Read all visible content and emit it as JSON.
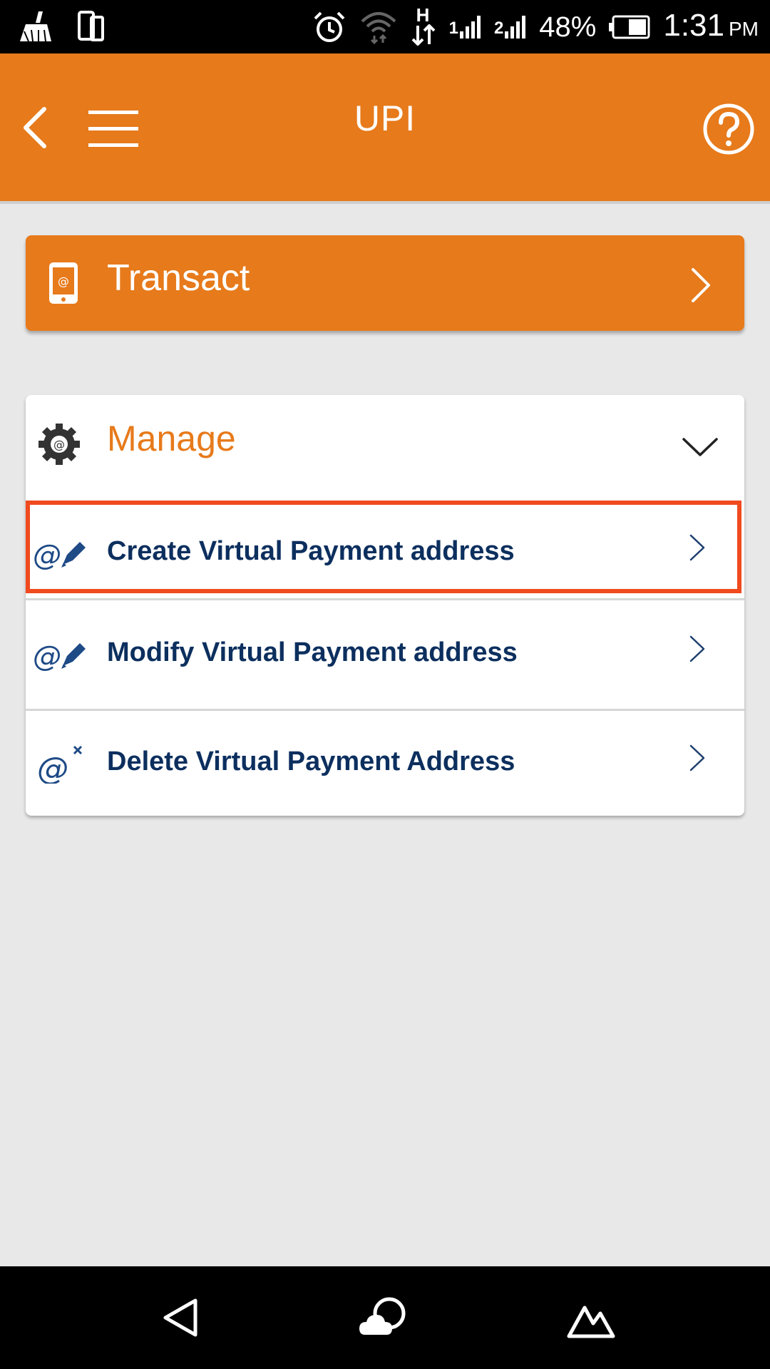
{
  "status_bar": {
    "battery_percent": "48%",
    "time": "1:31",
    "ampm": "PM",
    "sim1_label": "1",
    "sim2_label": "2",
    "network_type": "H"
  },
  "app_bar": {
    "title": "UPI"
  },
  "transact": {
    "label": "Transact"
  },
  "manage": {
    "label": "Manage",
    "items": [
      {
        "label": "Create Virtual Payment address",
        "icon": "at-edit-icon",
        "highlighted": true
      },
      {
        "label": "Modify Virtual Payment address",
        "icon": "at-edit-icon",
        "highlighted": false
      },
      {
        "label": "Delete Virtual Payment Address",
        "icon": "at-delete-icon",
        "highlighted": false
      }
    ]
  },
  "colors": {
    "brand_orange": "#e77a1b",
    "text_navy": "#0c2f5e",
    "highlight_red": "#f04a1e"
  }
}
